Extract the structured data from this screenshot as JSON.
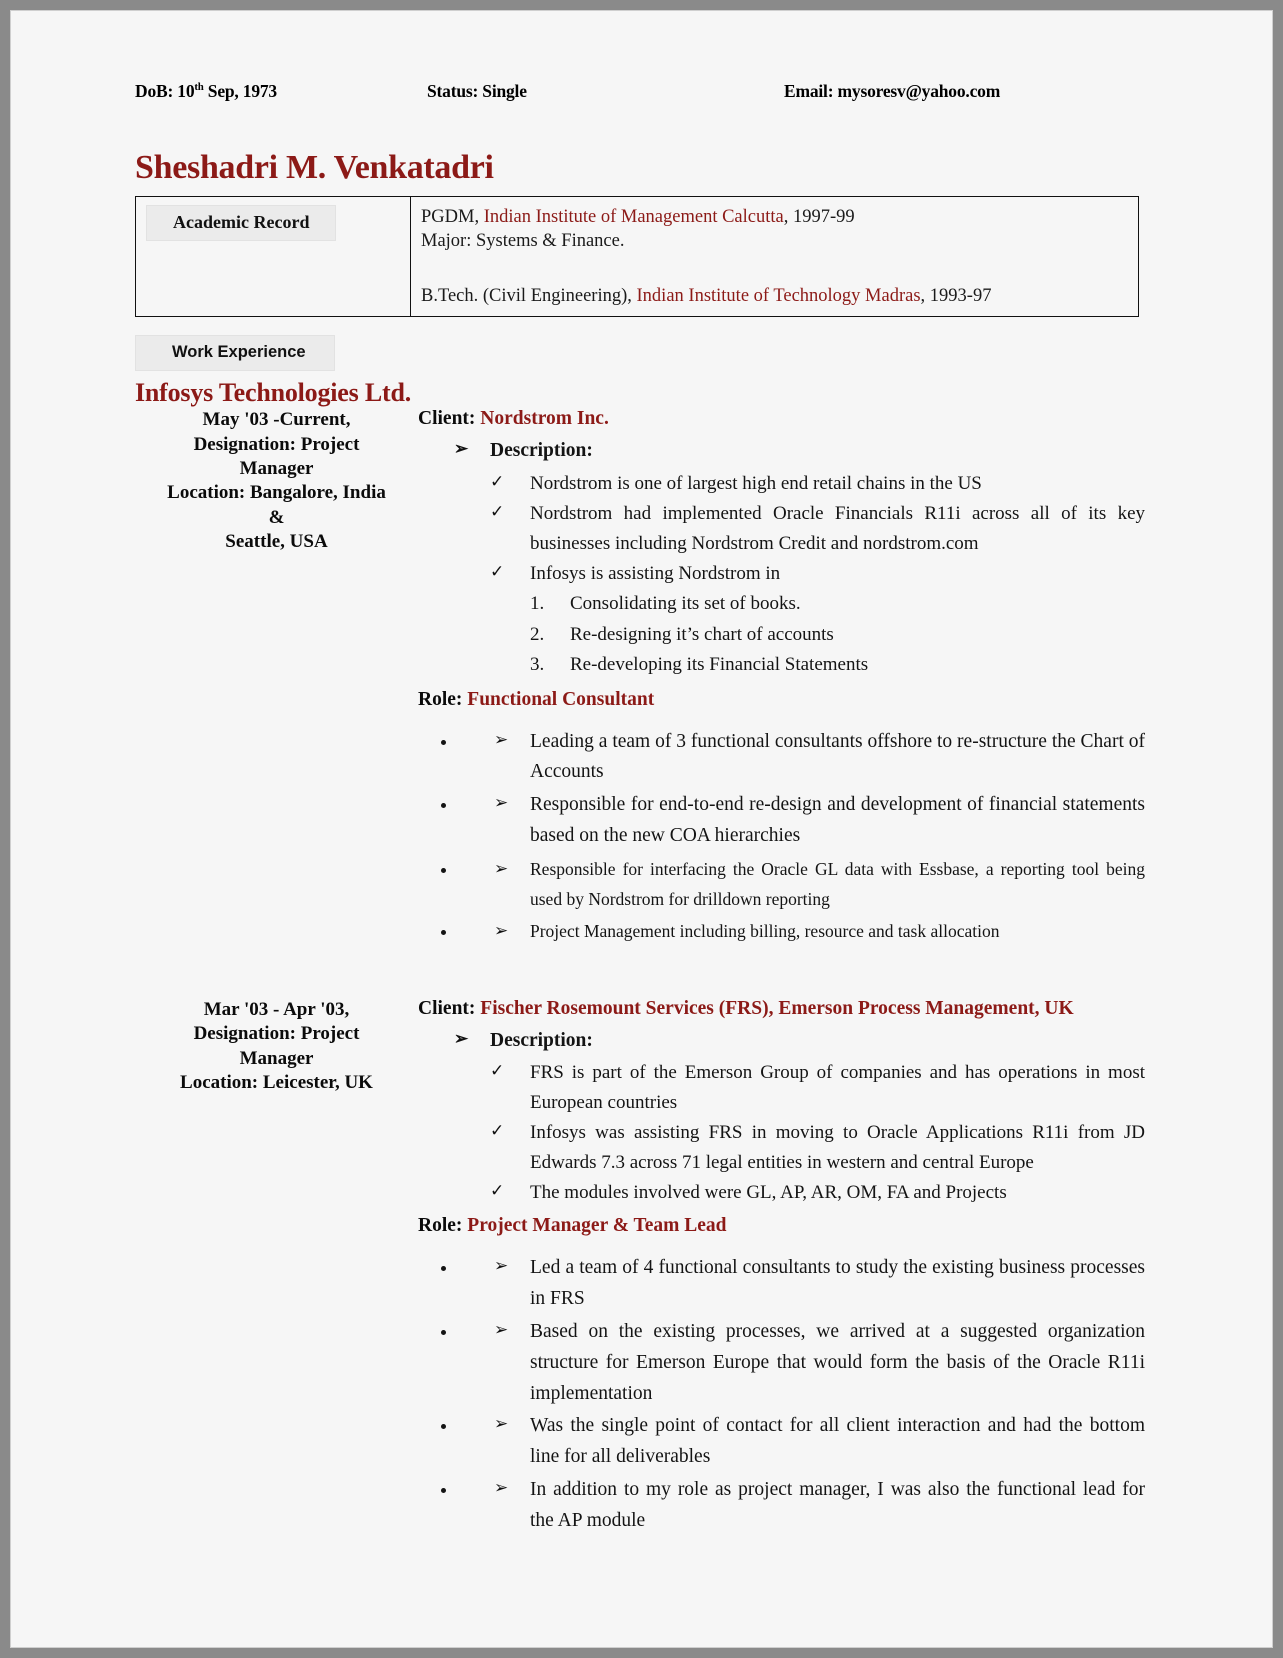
{
  "document": {
    "type": "resume",
    "accent_color": "#8c1a17",
    "text_color": "#141414",
    "page_background": "#f6f6f6",
    "frame_color": "#8a8a8a"
  },
  "header": {
    "dob_label": "DoB: 10",
    "dob_sup": "th",
    "dob_rest": " Sep, 1973",
    "status": "Status: Single",
    "email": "Email: mysoresv@yahoo.com"
  },
  "name": "Sheshadri M. Venkatadri",
  "academic": {
    "section_label": "Academic Record",
    "entries": [
      {
        "prefix": "PGDM, ",
        "institute": "Indian Institute of Management Calcutta",
        "suffix": ", 1997-99",
        "detail": "Major: Systems & Finance."
      },
      {
        "prefix": "B.Tech.  (Civil Engineering), ",
        "institute": "Indian Institute of Technology Madras",
        "suffix": ", 1993-97",
        "detail": ""
      }
    ]
  },
  "work": {
    "section_label": "Work Experience",
    "company": "Infosys Technologies Ltd.",
    "jobs": [
      {
        "period": "May '03 -Current,",
        "designation_line1": "Designation: Project",
        "designation_line2": "Manager",
        "location_line1": "Location: Bangalore, India",
        "location_line2": "&",
        "location_line3": "Seattle, USA",
        "client_label": "Client: ",
        "client_name": "Nordstrom Inc.",
        "description_label": "Description:",
        "description_items": [
          "Nordstrom is one of largest high end retail chains in the US",
          "Nordstrom had implemented Oracle Financials R11i across all of its key businesses including Nordstrom Credit and nordstrom.com",
          "Infosys is assisting Nordstrom in"
        ],
        "numbered_items": [
          "Consolidating its set of books.",
          "Re-designing it’s chart of accounts",
          "Re-developing its Financial Statements"
        ],
        "role_label": "Role: ",
        "role_name": "Functional Consultant",
        "role_items": [
          "Leading a team of 3 functional consultants offshore to re-structure the Chart of Accounts",
          "Responsible for end-to-end re-design and development of financial statements based on the new COA hierarchies",
          "Responsible for interfacing the Oracle GL data with Essbase, a reporting tool being used by Nordstrom for drilldown reporting",
          "Project Management including billing, resource and task allocation"
        ]
      },
      {
        "period": "Mar '03 - Apr '03,",
        "designation_line1": "Designation: Project",
        "designation_line2": "Manager",
        "location_line1": "Location: Leicester, UK",
        "location_line2": "",
        "location_line3": "",
        "client_label": "Client: ",
        "client_name": "Fischer Rosemount Services (FRS), Emerson Process Management, UK",
        "description_label": "Description:",
        "description_items": [
          "FRS is part of the Emerson Group of companies and has operations in most European countries",
          "Infosys was assisting FRS in moving to Oracle Applications R11i from JD Edwards 7.3 across 71 legal entities in western and central Europe",
          "The modules involved were GL, AP, AR, OM, FA and Projects"
        ],
        "numbered_items": [],
        "role_label": "Role: ",
        "role_name": "Project Manager & Team Lead",
        "role_items": [
          "Led a team of 4 functional consultants to study the existing business processes in FRS",
          "Based on the existing processes, we arrived at a suggested organization structure for Emerson Europe that would form the basis of the Oracle R11i implementation",
          "Was the single point of contact for all client interaction and had the bottom line for all deliverables",
          "In addition to my role as project manager, I was also the functional lead for the AP module"
        ]
      }
    ]
  },
  "glyphs": {
    "arrow_bullet": "➢",
    "check_bullet": "✓"
  }
}
